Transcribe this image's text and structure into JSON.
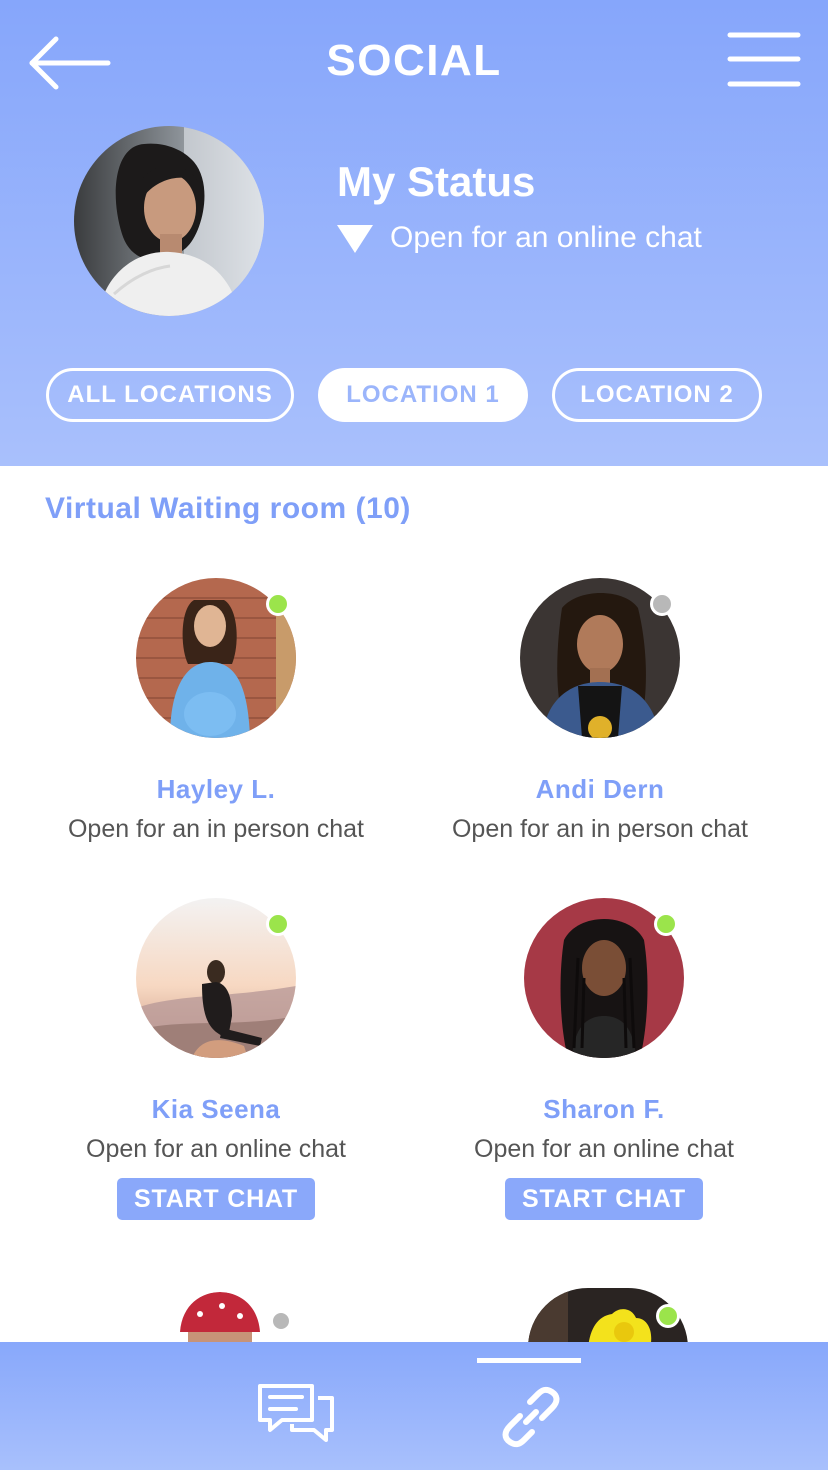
{
  "header": {
    "title": "SOCIAL",
    "back_icon": "arrow-left-icon",
    "menu_icon": "hamburger-menu-icon"
  },
  "my_status": {
    "title": "My Status",
    "value": "Open for an online chat"
  },
  "location_tabs": [
    {
      "label": "ALL LOCATIONS",
      "active": false
    },
    {
      "label": "LOCATION 1",
      "active": true
    },
    {
      "label": "LOCATION 2",
      "active": false
    }
  ],
  "waiting_room": {
    "title": "Virtual Waiting room (10)",
    "people": [
      {
        "name": "Hayley L.",
        "status": "Open for an in person chat",
        "online": true
      },
      {
        "name": "Andi Dern",
        "status": "Open for an in person chat",
        "online": false
      },
      {
        "name": "Kia Seena",
        "status": "Open for an online chat",
        "online": true,
        "action": "START CHAT"
      },
      {
        "name": "Sharon F.",
        "status": "Open for an online chat",
        "online": true,
        "action": "START CHAT"
      }
    ]
  },
  "bottom_nav": {
    "items": [
      "chat-bubbles-icon",
      "link-icon"
    ],
    "active": "link-icon"
  },
  "colors": {
    "accent": "#7f9ff8",
    "header_top": "#86a6fb",
    "header_bottom": "#a9c0fc",
    "online": "#9be44b",
    "offline": "#b8b8b8"
  }
}
